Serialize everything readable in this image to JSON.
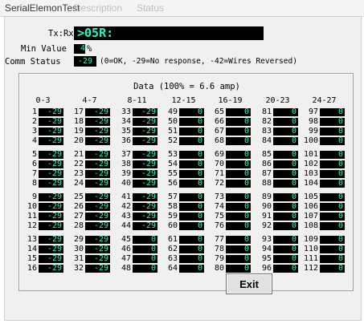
{
  "window": {
    "title": "SerialElemonTest",
    "menu_ghost_1": "Description",
    "menu_ghost_2": "Status"
  },
  "txrx": {
    "label": "Tx:Rx",
    "value": ">05R:"
  },
  "min_value": {
    "label": "Min Value",
    "value": "4",
    "unit": "%"
  },
  "comm_status": {
    "label": "Comm Status",
    "value": "-29",
    "legend": "(0=OK, -29=No response, -42=Wires Reversed)"
  },
  "data_panel": {
    "title": "Data (100% = 6.6 amp)",
    "groups": [
      "0-3",
      "4-7",
      "8-11",
      "12-15",
      "16-19",
      "20-23",
      "24-27"
    ],
    "columns": [
      {
        "rows": [
          1,
          2,
          3,
          4,
          5,
          6,
          7,
          8,
          9,
          10,
          11,
          12,
          13,
          14,
          15,
          16
        ],
        "values": [
          -29,
          -29,
          -29,
          -29,
          -29,
          -29,
          -29,
          -29,
          -29,
          -29,
          -29,
          -29,
          -29,
          -29,
          -29,
          -29
        ]
      },
      {
        "rows": [
          17,
          18,
          19,
          20,
          21,
          22,
          23,
          24,
          25,
          26,
          27,
          28,
          29,
          30,
          31,
          32
        ],
        "values": [
          -29,
          -29,
          -29,
          -29,
          -29,
          -29,
          -29,
          -29,
          -29,
          -29,
          -29,
          -29,
          -29,
          -29,
          -29,
          -29
        ]
      },
      {
        "rows": [
          33,
          34,
          35,
          36,
          37,
          38,
          39,
          40,
          41,
          42,
          43,
          44,
          45,
          46,
          47,
          48
        ],
        "values": [
          -29,
          -29,
          -29,
          -29,
          -29,
          -29,
          -29,
          -29,
          -29,
          -29,
          -29,
          -29,
          0,
          0,
          0,
          0
        ]
      },
      {
        "rows": [
          49,
          50,
          51,
          52,
          53,
          54,
          55,
          56,
          57,
          58,
          59,
          60,
          61,
          62,
          63,
          64
        ],
        "values": [
          0,
          0,
          0,
          0,
          0,
          0,
          0,
          0,
          0,
          0,
          0,
          0,
          0,
          0,
          0,
          0
        ]
      },
      {
        "rows": [
          65,
          66,
          67,
          68,
          69,
          70,
          71,
          72,
          73,
          74,
          75,
          76,
          77,
          78,
          79,
          80
        ],
        "values": [
          0,
          0,
          0,
          0,
          0,
          0,
          0,
          0,
          0,
          0,
          0,
          0,
          0,
          0,
          0,
          0
        ]
      },
      {
        "rows": [
          81,
          82,
          83,
          84,
          85,
          86,
          87,
          88,
          89,
          90,
          91,
          92,
          93,
          94,
          95,
          96
        ],
        "values": [
          0,
          0,
          0,
          0,
          0,
          0,
          0,
          0,
          0,
          0,
          0,
          0,
          0,
          0,
          0,
          0
        ]
      },
      {
        "rows": [
          97,
          98,
          99,
          100,
          101,
          102,
          103,
          104,
          105,
          106,
          107,
          108,
          109,
          110,
          111,
          112
        ],
        "values": [
          0,
          0,
          0,
          0,
          0,
          0,
          0,
          0,
          0,
          0,
          0,
          0,
          0,
          0,
          0,
          0
        ]
      }
    ]
  },
  "buttons": {
    "exit": "Exit"
  }
}
